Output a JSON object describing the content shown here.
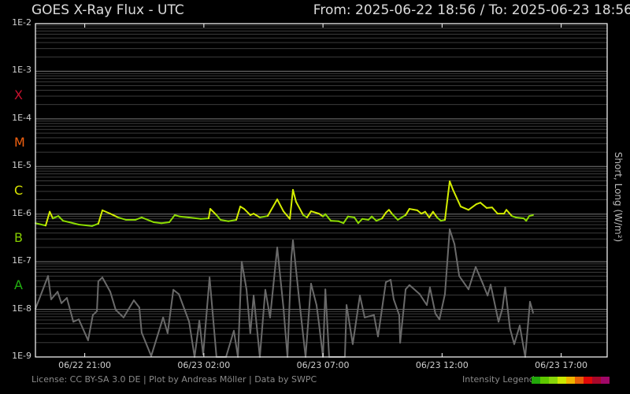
{
  "header": {
    "title": "GOES X-Ray Flux - UTC",
    "range": "From: 2025-06-22 18:56  /  To: 2025-06-23 18:56"
  },
  "footer": {
    "license": "License: CC BY-SA 3.0 DE | Plot by Andreas Möller | Data by SWPC",
    "legend_label": "Intensity Legend",
    "legend_colors": [
      "#22a80a",
      "#5ec800",
      "#88d60a",
      "#cce800",
      "#f0b400",
      "#e86008",
      "#e00808",
      "#a8082a",
      "#a00868"
    ]
  },
  "chart_data": {
    "type": "line",
    "title": "GOES X-Ray Flux - UTC",
    "ylabel": "Short, Long (W/m²)",
    "y_scale": "log",
    "ylim_log10": [
      -9,
      -2
    ],
    "x_unit": "hours since 2025-06-22 18:56 UTC",
    "xlim": [
      0,
      24
    ],
    "grid": true,
    "y_ticks": [
      {
        "log10": -2,
        "label": "1E-2"
      },
      {
        "log10": -3,
        "label": "1E-3"
      },
      {
        "log10": -4,
        "label": "1E-4"
      },
      {
        "log10": -5,
        "label": "1E-5"
      },
      {
        "log10": -6,
        "label": "1E-6"
      },
      {
        "log10": -7,
        "label": "1E-7"
      },
      {
        "log10": -8,
        "label": "1E-8"
      },
      {
        "log10": -9,
        "label": "1E-9"
      }
    ],
    "x_ticks": [
      {
        "x": 2.07,
        "label": "06/22 21:00"
      },
      {
        "x": 7.07,
        "label": "06/23 02:00"
      },
      {
        "x": 12.07,
        "label": "06/23 07:00"
      },
      {
        "x": 17.07,
        "label": "06/23 12:00"
      },
      {
        "x": 22.07,
        "label": "06/23 17:00"
      }
    ],
    "flare_classes": [
      {
        "label": "X",
        "log10": -3.5,
        "color": "#c8102e"
      },
      {
        "label": "M",
        "log10": -4.5,
        "color": "#f06010"
      },
      {
        "label": "C",
        "log10": -5.5,
        "color": "#d8e400"
      },
      {
        "label": "B",
        "log10": -6.5,
        "color": "#84cc00"
      },
      {
        "label": "A",
        "log10": -7.5,
        "color": "#22b010"
      }
    ],
    "series": [
      {
        "name": "Long",
        "color": "#8cdc00",
        "color_high": "#d4ee00",
        "points_log10": [
          [
            0,
            -6.19
          ],
          [
            0.43,
            -6.24
          ],
          [
            0.6,
            -5.95
          ],
          [
            0.73,
            -6.09
          ],
          [
            0.96,
            -6.04
          ],
          [
            1.16,
            -6.14
          ],
          [
            1.42,
            -6.17
          ],
          [
            1.82,
            -6.22
          ],
          [
            2.38,
            -6.25
          ],
          [
            2.64,
            -6.2
          ],
          [
            2.81,
            -5.92
          ],
          [
            3.14,
            -5.99
          ],
          [
            3.47,
            -6.07
          ],
          [
            3.8,
            -6.12
          ],
          [
            4.2,
            -6.12
          ],
          [
            4.46,
            -6.07
          ],
          [
            4.96,
            -6.17
          ],
          [
            5.29,
            -6.19
          ],
          [
            5.62,
            -6.17
          ],
          [
            5.85,
            -6.02
          ],
          [
            6.05,
            -6.05
          ],
          [
            6.45,
            -6.07
          ],
          [
            6.94,
            -6.1
          ],
          [
            7.27,
            -6.09
          ],
          [
            7.34,
            -5.89
          ],
          [
            7.6,
            -6.02
          ],
          [
            7.77,
            -6.12
          ],
          [
            8.1,
            -6.15
          ],
          [
            8.43,
            -6.12
          ],
          [
            8.6,
            -5.84
          ],
          [
            8.76,
            -5.89
          ],
          [
            9.02,
            -6.02
          ],
          [
            9.16,
            -5.99
          ],
          [
            9.42,
            -6.07
          ],
          [
            9.75,
            -6.04
          ],
          [
            10.15,
            -5.69
          ],
          [
            10.41,
            -5.94
          ],
          [
            10.68,
            -6.1
          ],
          [
            10.81,
            -5.49
          ],
          [
            10.94,
            -5.74
          ],
          [
            11.24,
            -6.02
          ],
          [
            11.4,
            -6.07
          ],
          [
            11.57,
            -5.94
          ],
          [
            11.9,
            -5.99
          ],
          [
            12.07,
            -6.05
          ],
          [
            12.17,
            -6.0
          ],
          [
            12.4,
            -6.14
          ],
          [
            12.73,
            -6.15
          ],
          [
            12.93,
            -6.19
          ],
          [
            13.12,
            -6.05
          ],
          [
            13.39,
            -6.07
          ],
          [
            13.55,
            -6.19
          ],
          [
            13.72,
            -6.1
          ],
          [
            13.98,
            -6.12
          ],
          [
            14.12,
            -6.05
          ],
          [
            14.31,
            -6.14
          ],
          [
            14.55,
            -6.09
          ],
          [
            14.71,
            -5.97
          ],
          [
            14.84,
            -5.91
          ],
          [
            14.98,
            -6.0
          ],
          [
            15.21,
            -6.12
          ],
          [
            15.54,
            -6.02
          ],
          [
            15.7,
            -5.89
          ],
          [
            16.03,
            -5.92
          ],
          [
            16.2,
            -5.99
          ],
          [
            16.36,
            -5.95
          ],
          [
            16.53,
            -6.07
          ],
          [
            16.69,
            -5.95
          ],
          [
            16.86,
            -6.07
          ],
          [
            17.02,
            -6.14
          ],
          [
            17.19,
            -6.12
          ],
          [
            17.39,
            -5.31
          ],
          [
            17.52,
            -5.48
          ],
          [
            17.85,
            -5.84
          ],
          [
            18.18,
            -5.91
          ],
          [
            18.51,
            -5.79
          ],
          [
            18.68,
            -5.76
          ],
          [
            18.94,
            -5.87
          ],
          [
            19.17,
            -5.86
          ],
          [
            19.4,
            -5.99
          ],
          [
            19.67,
            -5.99
          ],
          [
            19.77,
            -5.91
          ],
          [
            20.0,
            -6.04
          ],
          [
            20.17,
            -6.07
          ],
          [
            20.5,
            -6.09
          ],
          [
            20.6,
            -6.14
          ],
          [
            20.73,
            -6.04
          ],
          [
            20.89,
            -6.02
          ]
        ]
      },
      {
        "name": "Short",
        "color": "#6a6a6a",
        "points_log10": [
          [
            0,
            -7.99
          ],
          [
            0.53,
            -7.3
          ],
          [
            0.66,
            -7.79
          ],
          [
            0.93,
            -7.63
          ],
          [
            1.09,
            -7.87
          ],
          [
            1.32,
            -7.76
          ],
          [
            1.59,
            -8.26
          ],
          [
            1.82,
            -8.21
          ],
          [
            2.21,
            -8.65
          ],
          [
            2.41,
            -8.12
          ],
          [
            2.58,
            -8.04
          ],
          [
            2.64,
            -7.41
          ],
          [
            2.81,
            -7.33
          ],
          [
            3.14,
            -7.63
          ],
          [
            3.37,
            -8.01
          ],
          [
            3.7,
            -8.17
          ],
          [
            4.13,
            -7.81
          ],
          [
            4.36,
            -7.96
          ],
          [
            4.46,
            -8.49
          ],
          [
            4.86,
            -8.98
          ],
          [
            5.36,
            -8.17
          ],
          [
            5.55,
            -8.5
          ],
          [
            5.79,
            -7.59
          ],
          [
            6.02,
            -7.68
          ],
          [
            6.45,
            -8.26
          ],
          [
            6.68,
            -9.0
          ],
          [
            6.88,
            -8.24
          ],
          [
            7.04,
            -8.95
          ],
          [
            7.31,
            -7.33
          ],
          [
            7.6,
            -9.0
          ],
          [
            8.0,
            -9.0
          ],
          [
            8.33,
            -8.45
          ],
          [
            8.5,
            -9.0
          ],
          [
            8.66,
            -7.0
          ],
          [
            8.86,
            -7.58
          ],
          [
            9.02,
            -8.5
          ],
          [
            9.16,
            -7.71
          ],
          [
            9.42,
            -9.0
          ],
          [
            9.65,
            -7.59
          ],
          [
            9.85,
            -8.17
          ],
          [
            10.15,
            -6.7
          ],
          [
            10.41,
            -7.96
          ],
          [
            10.58,
            -9.0
          ],
          [
            10.74,
            -6.93
          ],
          [
            10.81,
            -6.55
          ],
          [
            11.07,
            -7.79
          ],
          [
            11.34,
            -9.0
          ],
          [
            11.57,
            -7.46
          ],
          [
            11.8,
            -7.91
          ],
          [
            11.9,
            -8.29
          ],
          [
            12.07,
            -9.0
          ],
          [
            12.17,
            -7.58
          ],
          [
            12.33,
            -9.0
          ],
          [
            12.99,
            -9.0
          ],
          [
            13.06,
            -7.91
          ],
          [
            13.32,
            -8.73
          ],
          [
            13.62,
            -7.71
          ],
          [
            13.82,
            -8.17
          ],
          [
            14.21,
            -8.12
          ],
          [
            14.38,
            -8.57
          ],
          [
            14.71,
            -7.43
          ],
          [
            14.91,
            -7.38
          ],
          [
            15.04,
            -7.79
          ],
          [
            15.27,
            -8.12
          ],
          [
            15.31,
            -8.7
          ],
          [
            15.54,
            -7.58
          ],
          [
            15.7,
            -7.49
          ],
          [
            16.13,
            -7.68
          ],
          [
            16.43,
            -7.91
          ],
          [
            16.56,
            -7.54
          ],
          [
            16.79,
            -8.09
          ],
          [
            16.96,
            -8.21
          ],
          [
            17.19,
            -7.68
          ],
          [
            17.39,
            -6.32
          ],
          [
            17.59,
            -6.63
          ],
          [
            17.79,
            -7.3
          ],
          [
            18.18,
            -7.58
          ],
          [
            18.48,
            -7.11
          ],
          [
            18.78,
            -7.46
          ],
          [
            18.98,
            -7.71
          ],
          [
            19.11,
            -7.48
          ],
          [
            19.44,
            -8.26
          ],
          [
            19.6,
            -7.99
          ],
          [
            19.72,
            -7.54
          ],
          [
            19.92,
            -8.4
          ],
          [
            20.1,
            -8.73
          ],
          [
            20.33,
            -8.34
          ],
          [
            20.56,
            -9.0
          ],
          [
            20.76,
            -7.84
          ],
          [
            20.89,
            -8.07
          ]
        ]
      }
    ]
  }
}
